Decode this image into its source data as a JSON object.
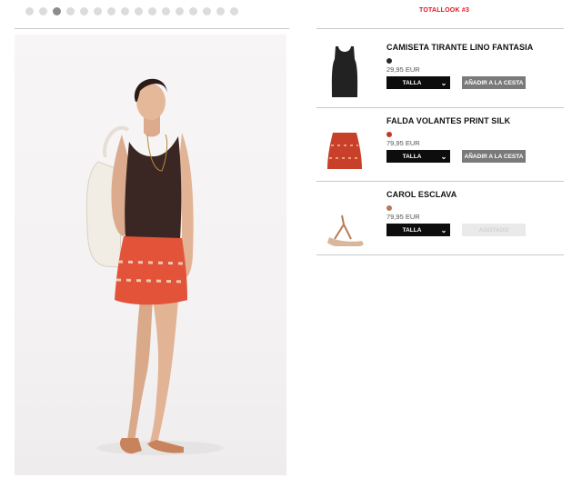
{
  "gallery": {
    "dot_count": 16,
    "active_index": 2
  },
  "look": {
    "title": "TOTALLOOK #3"
  },
  "products": [
    {
      "name": "CAMISETA TIRANTE LINO FANTASIA",
      "price": "29,95 EUR",
      "swatch_color": "#2a2a2a",
      "size_label": "TALLA",
      "button_label": "AÑADIR A LA CESTA",
      "button_enabled": true,
      "thumb": "tank-top"
    },
    {
      "name": "FALDA VOLANTES PRINT SILK",
      "price": "79,95 EUR",
      "swatch_color": "#c0392b",
      "size_label": "TALLA",
      "button_label": "AÑADIR A LA CESTA",
      "button_enabled": true,
      "thumb": "skirt"
    },
    {
      "name": "CAROL ESCLAVA",
      "price": "79,95 EUR",
      "swatch_color": "#b9785a",
      "size_label": "TALLA",
      "button_label": "AGOTADO",
      "button_enabled": false,
      "thumb": "sandal"
    }
  ],
  "colors": {
    "accent": "#e0141e",
    "button_dark": "#0d0d0d",
    "button_grey": "#7a7a7a",
    "button_disabled": "#eaeaea"
  }
}
